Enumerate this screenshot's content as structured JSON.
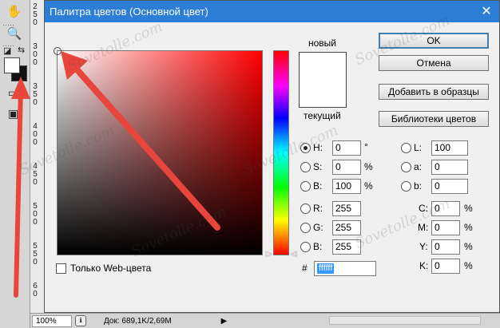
{
  "toolbar": {
    "hand_icon": "hand-icon",
    "zoom_icon": "zoom-icon"
  },
  "ruler": {
    "labels": [
      "2\n5\n0",
      "3\n0\n0",
      "3\n5\n0",
      "4\n0\n0",
      "4\n5\n0",
      "5\n0\n0",
      "5\n5\n0",
      "6\n0"
    ]
  },
  "status": {
    "zoom": "100%",
    "doc_info": "Док: 689,1K/2,69M"
  },
  "dialog": {
    "title": "Палитра цветов (Основной цвет)",
    "close": "✕",
    "new_label": "новый",
    "current_label": "текущий",
    "buttons": {
      "ok": "OK",
      "cancel": "Отмена",
      "add_swatches": "Добавить в образцы",
      "color_libraries": "Библиотеки цветов"
    },
    "hsb": {
      "h_label": "H:",
      "h_value": "0",
      "h_unit": "°",
      "s_label": "S:",
      "s_value": "0",
      "s_unit": "%",
      "b_label": "B:",
      "b_value": "100",
      "b_unit": "%"
    },
    "rgb": {
      "r_label": "R:",
      "r_value": "255",
      "g_label": "G:",
      "g_value": "255",
      "b_label": "B:",
      "b_value": "255"
    },
    "lab": {
      "l_label": "L:",
      "l_value": "100",
      "a_label": "a:",
      "a_value": "0",
      "b_label": "b:",
      "b_value": "0"
    },
    "cmyk": {
      "c_label": "C:",
      "c_value": "0",
      "m_label": "M:",
      "m_value": "0",
      "y_label": "Y:",
      "y_value": "0",
      "k_label": "K:",
      "k_value": "0",
      "unit": "%"
    },
    "web_only_label": "Только Web-цвета",
    "hex_label": "#",
    "hex_value": "ffffff",
    "selected_hue": "#ff0000",
    "selected_color": "#ffffff"
  },
  "watermark": "Sovetolle.com",
  "accent_color": "#e8453c"
}
